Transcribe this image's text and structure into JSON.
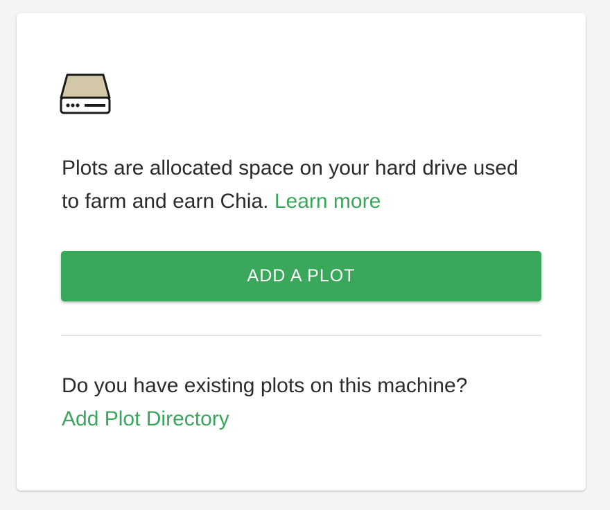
{
  "card": {
    "icon": "hard-drive-icon",
    "description": "Plots are allocated space on your hard drive used to farm and earn Chia.",
    "learn_more_label": "Learn more",
    "add_plot_label": "ADD A PLOT",
    "question": "Do you have existing plots on this machine?",
    "add_directory_label": "Add Plot Directory"
  },
  "colors": {
    "accent": "#3aa85b",
    "link": "#3aa55c",
    "text": "#2b2b2b",
    "icon_fill": "#d2c7a6"
  }
}
